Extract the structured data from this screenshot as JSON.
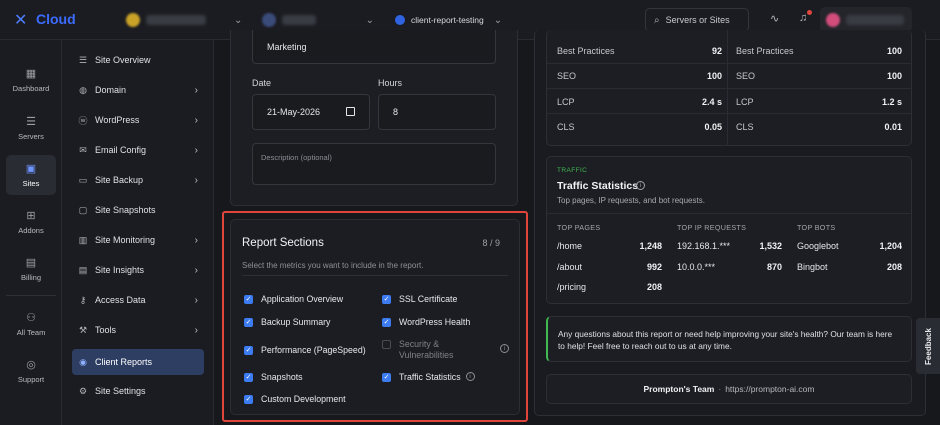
{
  "topbar": {
    "logo_text": "Cloud",
    "breadcrumb_site": "client-report-testing",
    "search_label": "Servers or Sites"
  },
  "leftnav": [
    {
      "label": "Dashboard",
      "icon": "dashboard-icon"
    },
    {
      "label": "Servers",
      "icon": "servers-icon"
    },
    {
      "label": "Sites",
      "icon": "sites-icon",
      "active": true
    },
    {
      "label": "Addons",
      "icon": "addons-icon"
    },
    {
      "label": "Billing",
      "icon": "billing-icon"
    },
    {
      "label": "All Team",
      "icon": "team-icon"
    },
    {
      "label": "Support",
      "icon": "support-icon"
    }
  ],
  "subnav": [
    {
      "label": "Site Overview",
      "arrow": false
    },
    {
      "label": "Domain",
      "arrow": true
    },
    {
      "label": "WordPress",
      "arrow": true
    },
    {
      "label": "Email Config",
      "arrow": true
    },
    {
      "label": "Site Backup",
      "arrow": true
    },
    {
      "label": "Site Snapshots",
      "arrow": false
    },
    {
      "label": "Site Monitoring",
      "arrow": true
    },
    {
      "label": "Site Insights",
      "arrow": true
    },
    {
      "label": "Access Data",
      "arrow": true
    },
    {
      "label": "Tools",
      "arrow": true
    },
    {
      "label": "Client Reports",
      "arrow": false,
      "active": true
    },
    {
      "label": "Site Settings",
      "arrow": false
    }
  ],
  "form": {
    "category_value": "Marketing",
    "date_label": "Date",
    "date_value": "21-May-2026",
    "hours_label": "Hours",
    "hours_value": "8",
    "description_placeholder": "Description (optional)"
  },
  "report_sections": {
    "title": "Report Sections",
    "count": "8 / 9",
    "subtitle": "Select the metrics you want to include in the report.",
    "items": [
      {
        "label": "Application Overview",
        "checked": true
      },
      {
        "label": "SSL Certificate",
        "checked": true
      },
      {
        "label": "Backup Summary",
        "checked": true
      },
      {
        "label": "WordPress Health",
        "checked": true
      },
      {
        "label": "Performance (PageSpeed)",
        "checked": true
      },
      {
        "label": "Security & Vulnerabilities",
        "checked": false
      },
      {
        "label": "Snapshots",
        "checked": true
      },
      {
        "label": "Traffic Statistics",
        "checked": true
      },
      {
        "label": "Custom Development",
        "checked": true
      }
    ]
  },
  "pagespeed": {
    "left": [
      {
        "k": "Best Practices",
        "v": "92"
      },
      {
        "k": "SEO",
        "v": "100"
      },
      {
        "k": "LCP",
        "v": "2.4 s"
      },
      {
        "k": "CLS",
        "v": "0.05"
      }
    ],
    "right": [
      {
        "k": "Best Practices",
        "v": "100"
      },
      {
        "k": "SEO",
        "v": "100"
      },
      {
        "k": "LCP",
        "v": "1.2 s"
      },
      {
        "k": "CLS",
        "v": "0.01"
      }
    ]
  },
  "traffic": {
    "eyebrow": "TRAFFIC",
    "title": "Traffic Statistics",
    "subtitle": "Top pages, IP requests, and bot requests.",
    "col1_header": "TOP PAGES",
    "col2_header": "TOP IP REQUESTS",
    "col3_header": "TOP BOTS",
    "pages": [
      {
        "k": "/home",
        "v": "1,248"
      },
      {
        "k": "/about",
        "v": "992"
      },
      {
        "k": "/pricing",
        "v": "208"
      }
    ],
    "ips": [
      {
        "k": "192.168.1.***",
        "v": "1,532"
      },
      {
        "k": "10.0.0.***",
        "v": "870"
      }
    ],
    "bots": [
      {
        "k": "Googlebot",
        "v": "1,204"
      },
      {
        "k": "Bingbot",
        "v": "208"
      }
    ]
  },
  "help_note": "Any questions about this report or need help improving your site's health? Our team is here to help! Feel free to reach out to us at any time.",
  "footer": {
    "team": "Prompton's Team",
    "sep": "·",
    "url": "https://prompton-ai.com"
  },
  "feedback_label": "Feedback",
  "colors": {
    "accent": "#3d7bf0",
    "highlight_border": "#e0453b",
    "traffic_green": "#3fb950"
  }
}
